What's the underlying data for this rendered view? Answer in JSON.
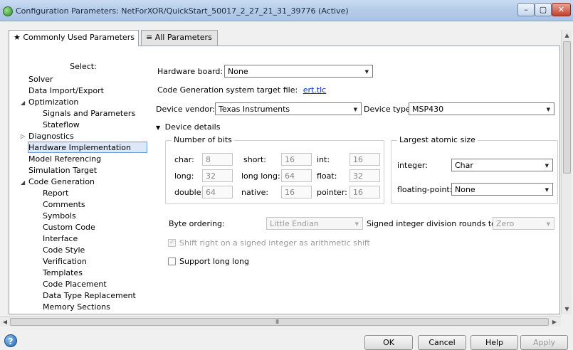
{
  "window": {
    "title": "Configuration Parameters: NetForXOR/QuickStart_50017_2_27_21_31_39776 (Active)",
    "buttons": {
      "minimize": "–",
      "maximize": "▢",
      "close": "✕"
    }
  },
  "tabs": [
    {
      "label": "★ Commonly Used Parameters"
    },
    {
      "label": "≡ All Parameters"
    }
  ],
  "tree": {
    "header": "Select:",
    "items": [
      {
        "label": "Solver"
      },
      {
        "label": "Data Import/Export"
      },
      {
        "label": "Optimization"
      },
      {
        "label": "Signals and Parameters"
      },
      {
        "label": "Stateflow"
      },
      {
        "label": "Diagnostics"
      },
      {
        "label": "Hardware Implementation"
      },
      {
        "label": "Model Referencing"
      },
      {
        "label": "Simulation Target"
      },
      {
        "label": "Code Generation"
      },
      {
        "label": "Report"
      },
      {
        "label": "Comments"
      },
      {
        "label": "Symbols"
      },
      {
        "label": "Custom Code"
      },
      {
        "label": "Interface"
      },
      {
        "label": "Code Style"
      },
      {
        "label": "Verification"
      },
      {
        "label": "Templates"
      },
      {
        "label": "Code Placement"
      },
      {
        "label": "Data Type Replacement"
      },
      {
        "label": "Memory Sections"
      }
    ],
    "expanders": {
      "expanded": "◢",
      "collapsed": "▷"
    }
  },
  "hardware": {
    "board_label": "Hardware board:",
    "board_value": "None",
    "target_file_label": "Code Generation system target file:",
    "target_file_value": "ert.tlc",
    "vendor_label": "Device vendor:",
    "vendor_value": "Texas Instruments",
    "type_label": "Device type:",
    "type_value": "MSP430",
    "details_label": "Device details",
    "details_marker": "▼"
  },
  "bits": {
    "title": "Number of bits",
    "fields": [
      {
        "label": "char:",
        "value": "8"
      },
      {
        "label": "short:",
        "value": "16"
      },
      {
        "label": "int:",
        "value": "16"
      },
      {
        "label": "long:",
        "value": "32"
      },
      {
        "label": "long long:",
        "value": "64"
      },
      {
        "label": "float:",
        "value": "32"
      },
      {
        "label": "double:",
        "value": "64"
      },
      {
        "label": "native:",
        "value": "16"
      },
      {
        "label": "pointer:",
        "value": "16"
      }
    ]
  },
  "atomic": {
    "title": "Largest atomic size",
    "integer_label": "integer:",
    "integer_value": "Char",
    "float_label": "floating-point:",
    "float_value": "None"
  },
  "ordering": {
    "byte_label": "Byte ordering:",
    "byte_value": "Little Endian",
    "div_label": "Signed integer division rounds to:",
    "div_value": "Zero",
    "shift_label": "Shift right on a signed integer as arithmetic shift",
    "longlong_label": "Support long long",
    "check_mark": "✓"
  },
  "scroll": {
    "grip": "III",
    "up": "▲",
    "down": "▼",
    "left": "◀",
    "right": "▶"
  },
  "footer": {
    "help_icon": "?",
    "ok": "OK",
    "cancel": "Cancel",
    "help": "Help",
    "apply": "Apply"
  }
}
